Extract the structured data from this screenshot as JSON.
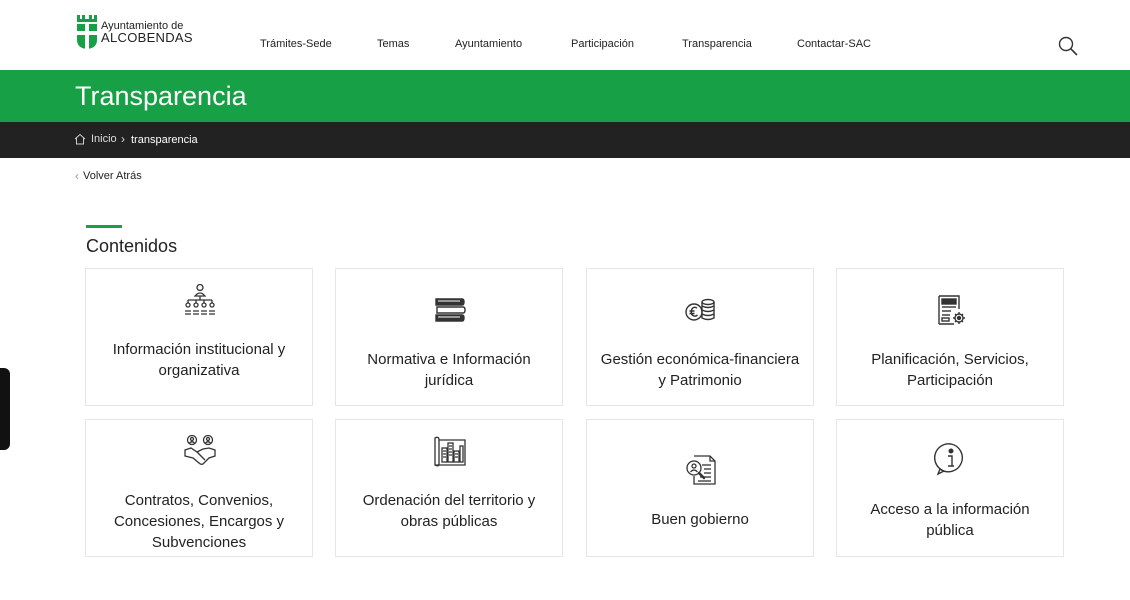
{
  "header": {
    "logo_line1": "Ayuntamiento de",
    "logo_line2": "ALCOBENDAS",
    "nav": [
      "Trámites-Sede",
      "Temas",
      "Ayuntamiento",
      "Participación",
      "Transparencia",
      "Contactar-SAC"
    ]
  },
  "hero": {
    "title": "Transparencia"
  },
  "breadcrumb": {
    "home": "Inicio",
    "separator": "›",
    "current": "transparencia"
  },
  "back_link": "Volver Atrás",
  "section": {
    "title": "Contenidos"
  },
  "cards": [
    {
      "label": "Información institucional y organizativa",
      "icon": "org-chart-icon"
    },
    {
      "label": "Normativa e Información jurídica",
      "icon": "books-icon"
    },
    {
      "label": "Gestión económica-financiera y Patrimonio",
      "icon": "euro-coins-icon"
    },
    {
      "label": "Planificación, Servicios, Participación",
      "icon": "document-gear-icon"
    },
    {
      "label": "Contratos, Convenios, Concesiones, Encargos y Subvenciones",
      "icon": "handshake-icon"
    },
    {
      "label": "Ordenación del territorio y obras públicas",
      "icon": "city-plan-icon"
    },
    {
      "label": "Buen gobierno",
      "icon": "document-search-icon"
    },
    {
      "label": "Acceso a la información pública",
      "icon": "info-icon"
    }
  ],
  "colors": {
    "brand_green": "#17a046",
    "breadcrumb_bg": "#222222"
  }
}
